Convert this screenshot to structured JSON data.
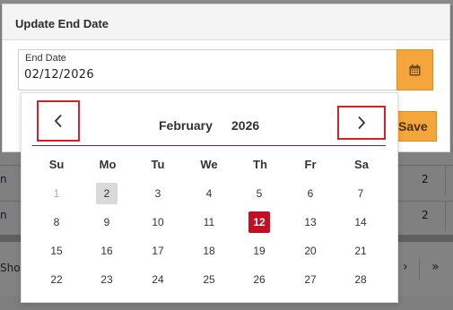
{
  "background": {
    "rows": [
      {
        "cell_a": "n",
        "cell_b": "2"
      },
      {
        "cell_a": "n",
        "cell_b": "2"
      }
    ],
    "pager": {
      "show_label": "Sho",
      "next_icon": "›",
      "last_icon": "»"
    }
  },
  "dialog": {
    "title": "Update End Date",
    "field_label": "End Date",
    "field_value": "02/12/2026",
    "calendar_icon": "calendar-icon",
    "save_label": "Save"
  },
  "calendar": {
    "month": "February",
    "year": "2026",
    "prev_icon": "chevron-left-icon",
    "next_icon": "chevron-right-icon",
    "weekdays": [
      "Su",
      "Mo",
      "Tu",
      "We",
      "Th",
      "Fr",
      "Sa"
    ],
    "weeks": [
      [
        "1",
        "2",
        "3",
        "4",
        "5",
        "6",
        "7"
      ],
      [
        "8",
        "9",
        "10",
        "11",
        "12",
        "13",
        "14"
      ],
      [
        "15",
        "16",
        "17",
        "18",
        "19",
        "20",
        "21"
      ],
      [
        "22",
        "23",
        "24",
        "25",
        "26",
        "27",
        "28"
      ]
    ],
    "muted_day": "1",
    "selected_day": "2",
    "highlighted_day": "12",
    "accent_color": "#c10f23",
    "button_color": "#f4a53c"
  }
}
